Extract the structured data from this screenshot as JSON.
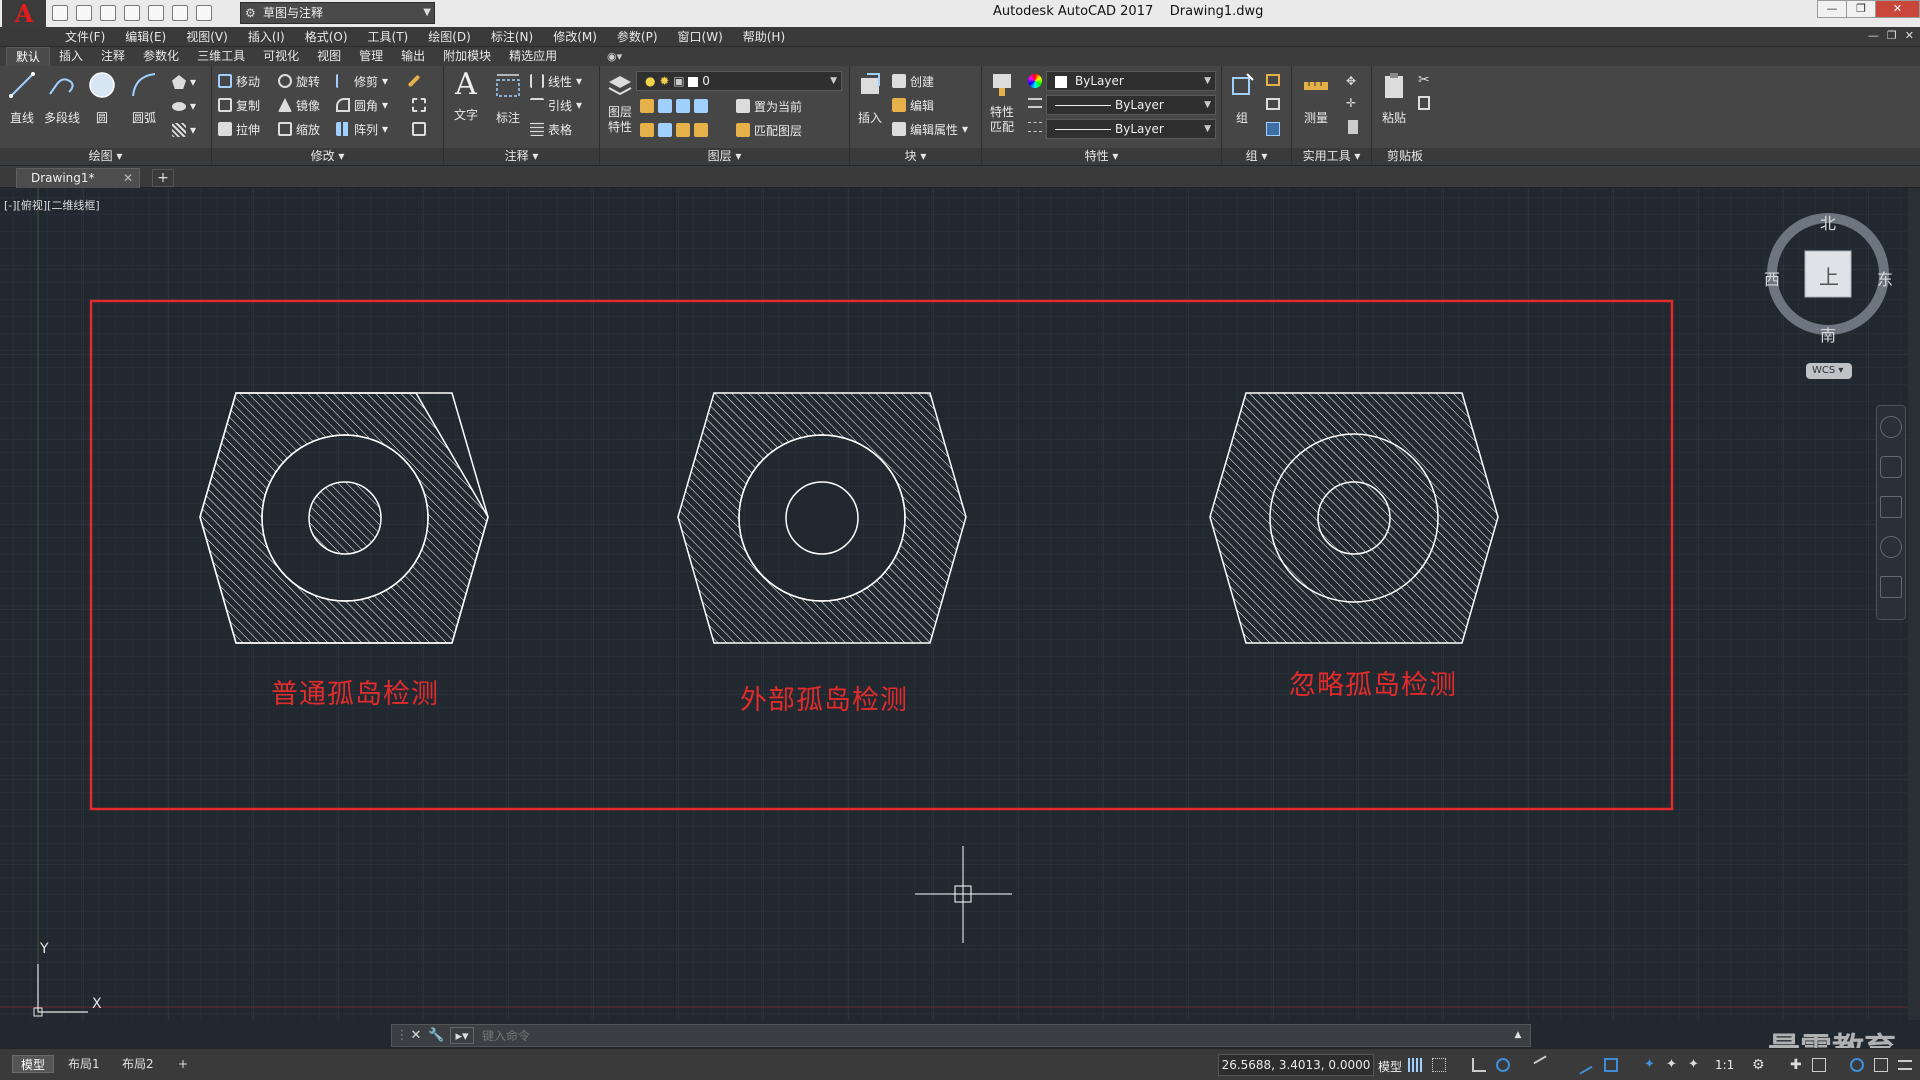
{
  "titlebar": {
    "app_logo": "A",
    "workspace": "草图与注释",
    "title": "Autodesk AutoCAD 2017    Drawing1.dwg"
  },
  "menu": [
    "文件(F)",
    "编辑(E)",
    "视图(V)",
    "插入(I)",
    "格式(O)",
    "工具(T)",
    "绘图(D)",
    "标注(N)",
    "修改(M)",
    "参数(P)",
    "窗口(W)",
    "帮助(H)"
  ],
  "ribbon_tabs": [
    "默认",
    "插入",
    "注释",
    "参数化",
    "三维工具",
    "可视化",
    "视图",
    "管理",
    "输出",
    "附加模块",
    "精选应用"
  ],
  "ribbon": {
    "draw": {
      "title": "绘图",
      "tools": [
        "直线",
        "多段线",
        "圆",
        "圆弧"
      ]
    },
    "modify": {
      "title": "修改",
      "tools": [
        "移动",
        "旋转",
        "修剪",
        "复制",
        "镜像",
        "圆角",
        "拉伸",
        "缩放",
        "阵列"
      ]
    },
    "annotation": {
      "title": "注释",
      "tools": [
        "文字",
        "标注",
        "线性",
        "引线",
        "表格"
      ]
    },
    "layers": {
      "title": "图层",
      "props_label": "图层\n特性",
      "layer_value": "0",
      "tools": [
        "置为当前",
        "匹配图层"
      ]
    },
    "block": {
      "title": "块",
      "tools": [
        "插入",
        "创建",
        "编辑",
        "编辑属性"
      ]
    },
    "properties": {
      "title": "特性",
      "match_label": "特性\n匹配",
      "color": "ByLayer",
      "linetype": "ByLayer",
      "lineweight": "ByLayer"
    },
    "groups": {
      "title": "组",
      "tool": "组"
    },
    "utilities": {
      "title": "实用工具",
      "tool": "测量"
    },
    "clipboard": {
      "title": "剪贴板",
      "tool": "粘贴"
    }
  },
  "file_tab": {
    "name": "Drawing1*"
  },
  "viewport_label": "[-][俯视][二维线框]",
  "viewcube": {
    "north": "北",
    "south": "南",
    "east": "东",
    "west": "西",
    "face": "上",
    "wcs": "WCS"
  },
  "drawing": {
    "labels": [
      "普通孤岛检测",
      "外部孤岛检测",
      "忽略孤岛检测"
    ],
    "ucs_x": "X",
    "ucs_y": "Y",
    "colors": {
      "frame": "#e22b2b",
      "geometry": "#ffffff",
      "background": "#212830"
    }
  },
  "command_line": {
    "placeholder": "键入命令"
  },
  "status": {
    "layouts": [
      "模型",
      "布局1",
      "布局2"
    ],
    "coords": "26.5688, 3.4013, 0.0000",
    "mode": "模型",
    "scale": "1:1"
  },
  "watermark": "最需教育"
}
